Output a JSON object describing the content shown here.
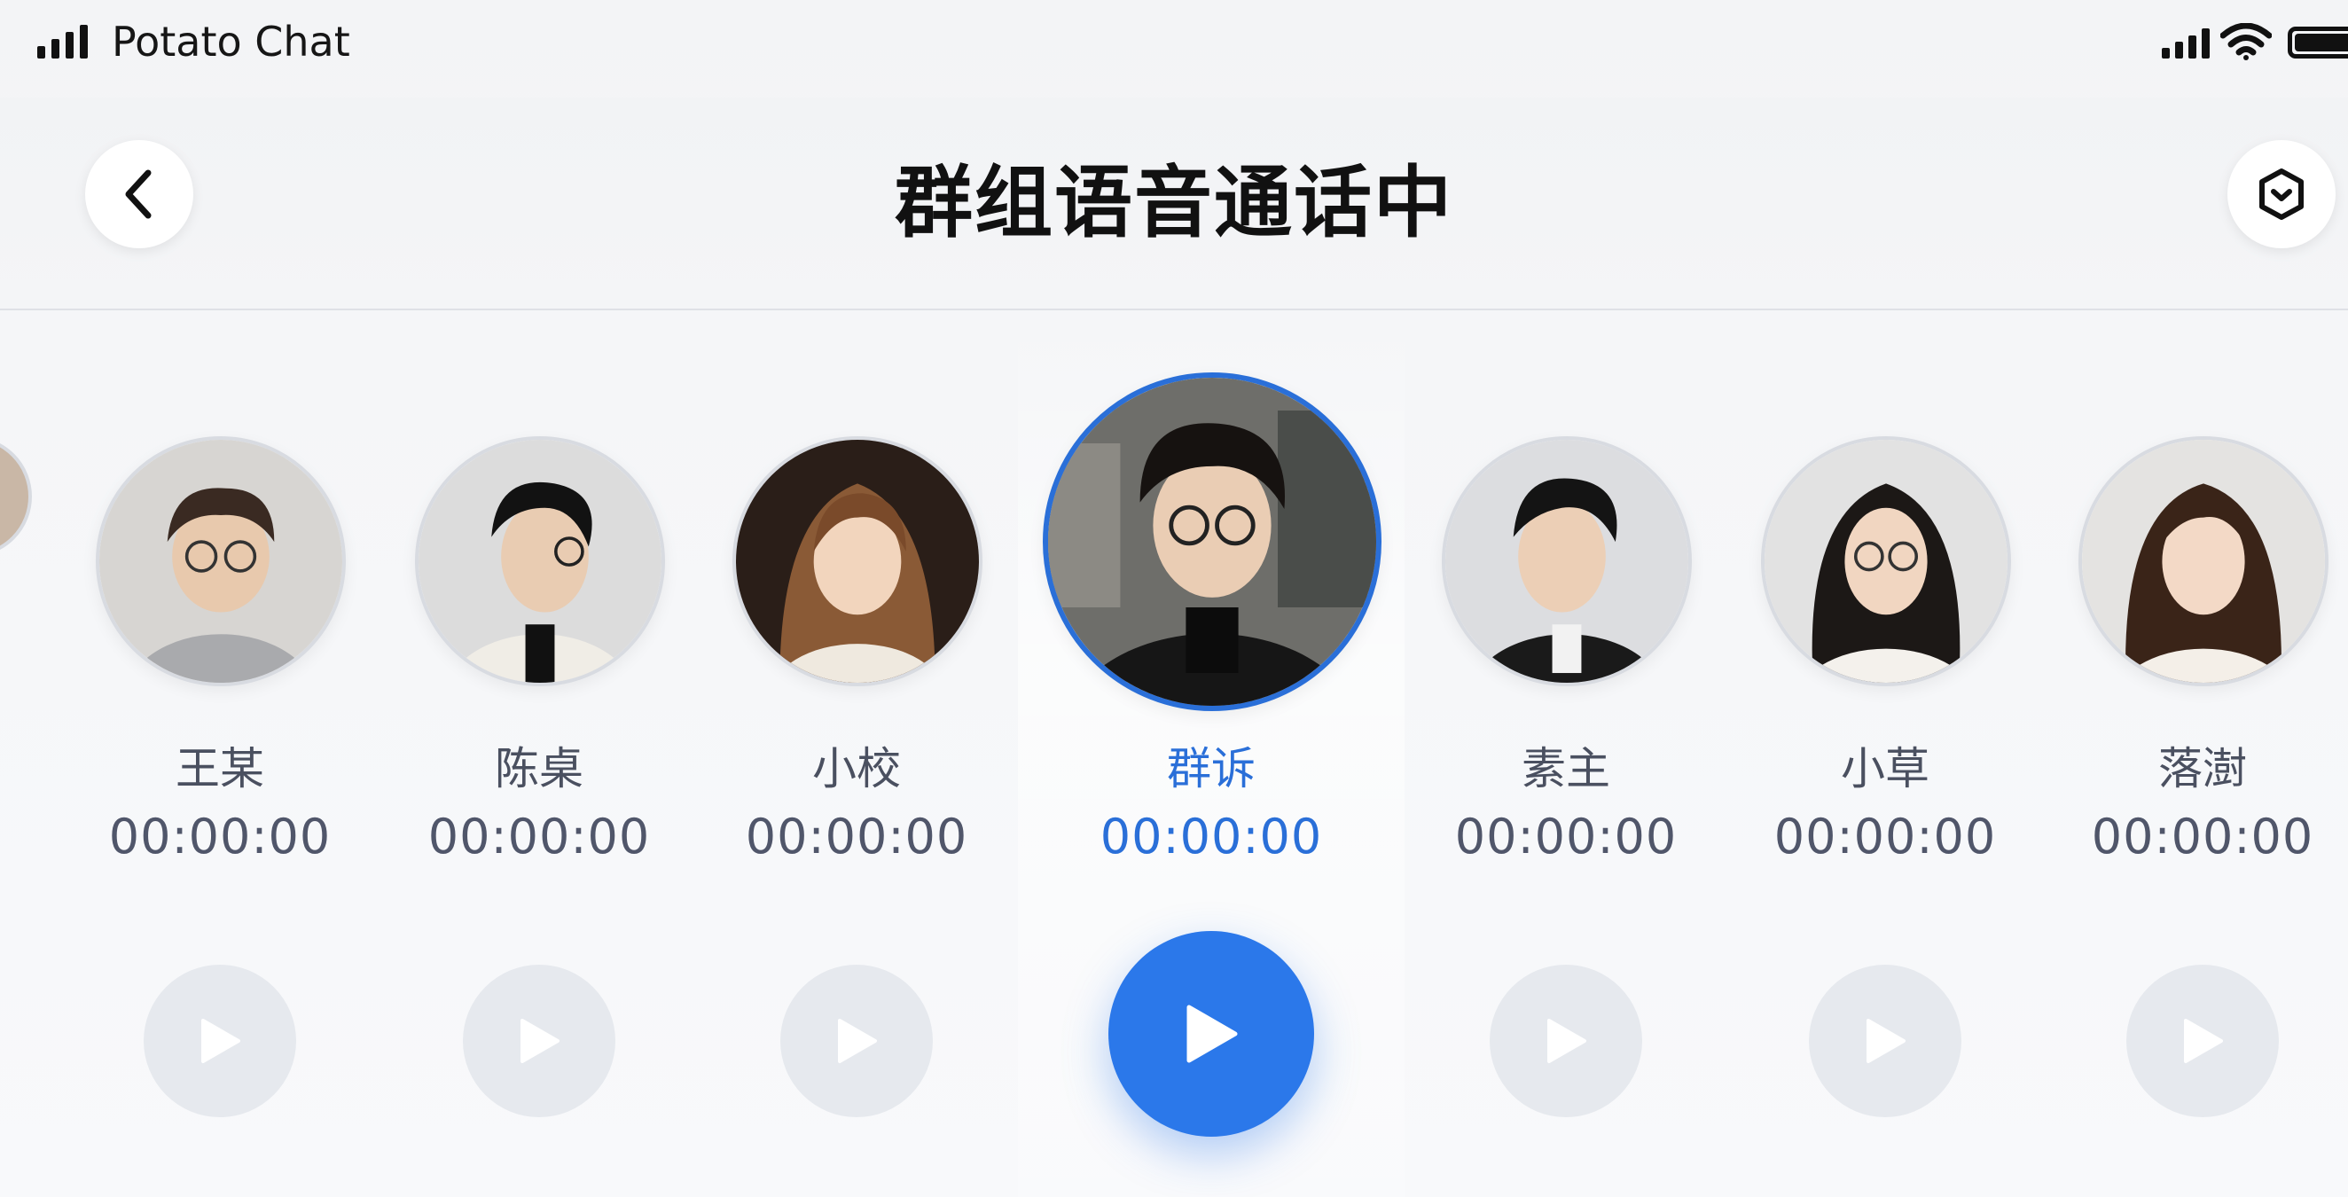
{
  "status_bar": {
    "app_name": "Potato Chat"
  },
  "nav": {
    "title": "群组语音通话中"
  },
  "colors": {
    "accent": "#2b78ea",
    "inactive_play": "#e6e9ee"
  },
  "participants": [
    {
      "name": "王某",
      "time": "00:00:00",
      "active": false
    },
    {
      "name": "陈桌",
      "time": "00:00:00",
      "active": false
    },
    {
      "name": "小校",
      "time": "00:00:00",
      "active": false
    },
    {
      "name": "群诉",
      "time": "00:00:00",
      "active": true
    },
    {
      "name": "素主",
      "time": "00:00:00",
      "active": false
    },
    {
      "name": "小草",
      "time": "00:00:00",
      "active": false
    },
    {
      "name": "落澍",
      "time": "00:00:00",
      "active": false
    }
  ]
}
